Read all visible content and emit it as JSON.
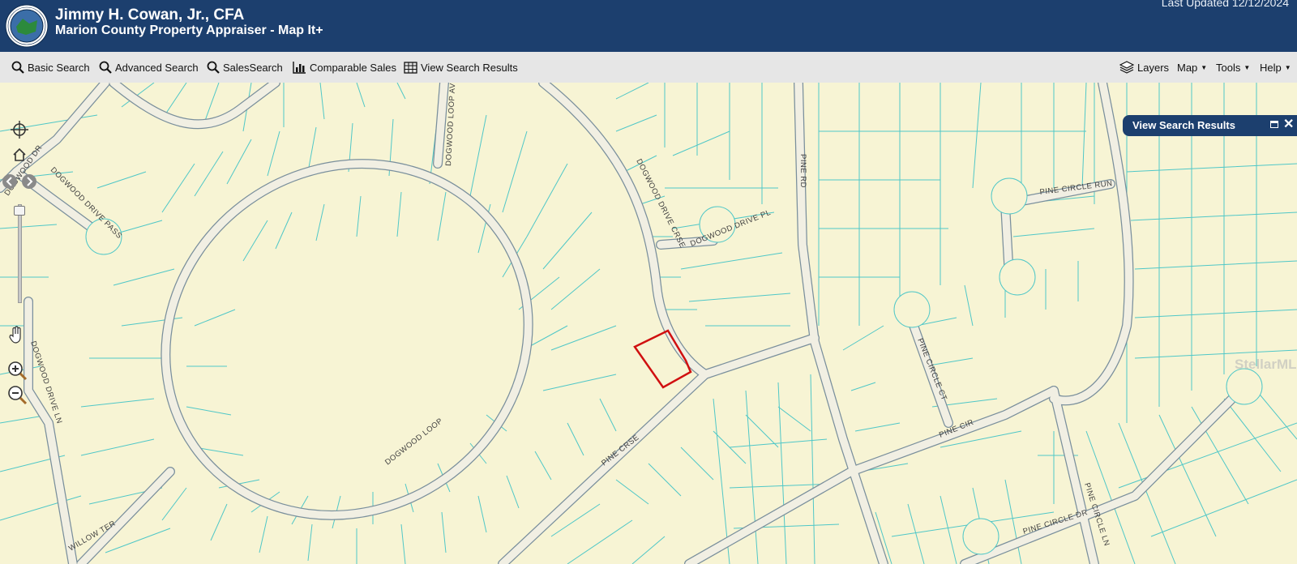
{
  "header": {
    "title": "Jimmy H. Cowan, Jr., CFA",
    "subtitle": "Marion County Property Appraiser - Map It+",
    "last_updated": "Last Updated 12/12/2024",
    "seal_text": "PROPERTY APPRAISER MARION COUNTY"
  },
  "toolbar": {
    "basic_search": "Basic Search",
    "advanced_search": "Advanced Search",
    "sales_search": "SalesSearch",
    "comparable_sales": "Comparable Sales",
    "view_search_results": "View Search Results",
    "layers": "Layers",
    "map": "Map",
    "tools": "Tools",
    "help": "Help"
  },
  "panel": {
    "title": "View Search Results",
    "close": "✕"
  },
  "watermark": "StellarMLS",
  "streets": {
    "dogwood_loop_ave": "DOGWOOD LOOP AVE",
    "dogwood_drive_crse": "DOGWOOD DRIVE CRSE",
    "dogwood_drive_pl": "DOGWOOD DRIVE PL",
    "pine_rd": "PINE RD",
    "pine_circle_run": "PINE CIRCLE RUN",
    "dogwood_drive_pass": "DOGWOOD DRIVE PASS",
    "dogwood_dr": "DOGWOOD DR",
    "dogwood_drive_ln": "DOGWOOD DRIVE LN",
    "dogwood_loop": "DOGWOOD LOOP",
    "pine_crse": "PINE CRSE",
    "pine_circle_ct": "PINE CIRCLE CT",
    "pine_cir": "PINE CIR",
    "pine_circle_dr": "PINE CIRCLE DR",
    "pine_circle_ln": "PINE CIRCLE LN",
    "willow_ter": "WILLOW TER"
  },
  "colors": {
    "header_bg": "#1c3f6e",
    "map_bg": "#f7f4d4",
    "parcel_line": "#4fc7c7",
    "road_fill": "#f1efe3",
    "road_edge": "#7a8f9c",
    "highlight": "#d01010"
  }
}
